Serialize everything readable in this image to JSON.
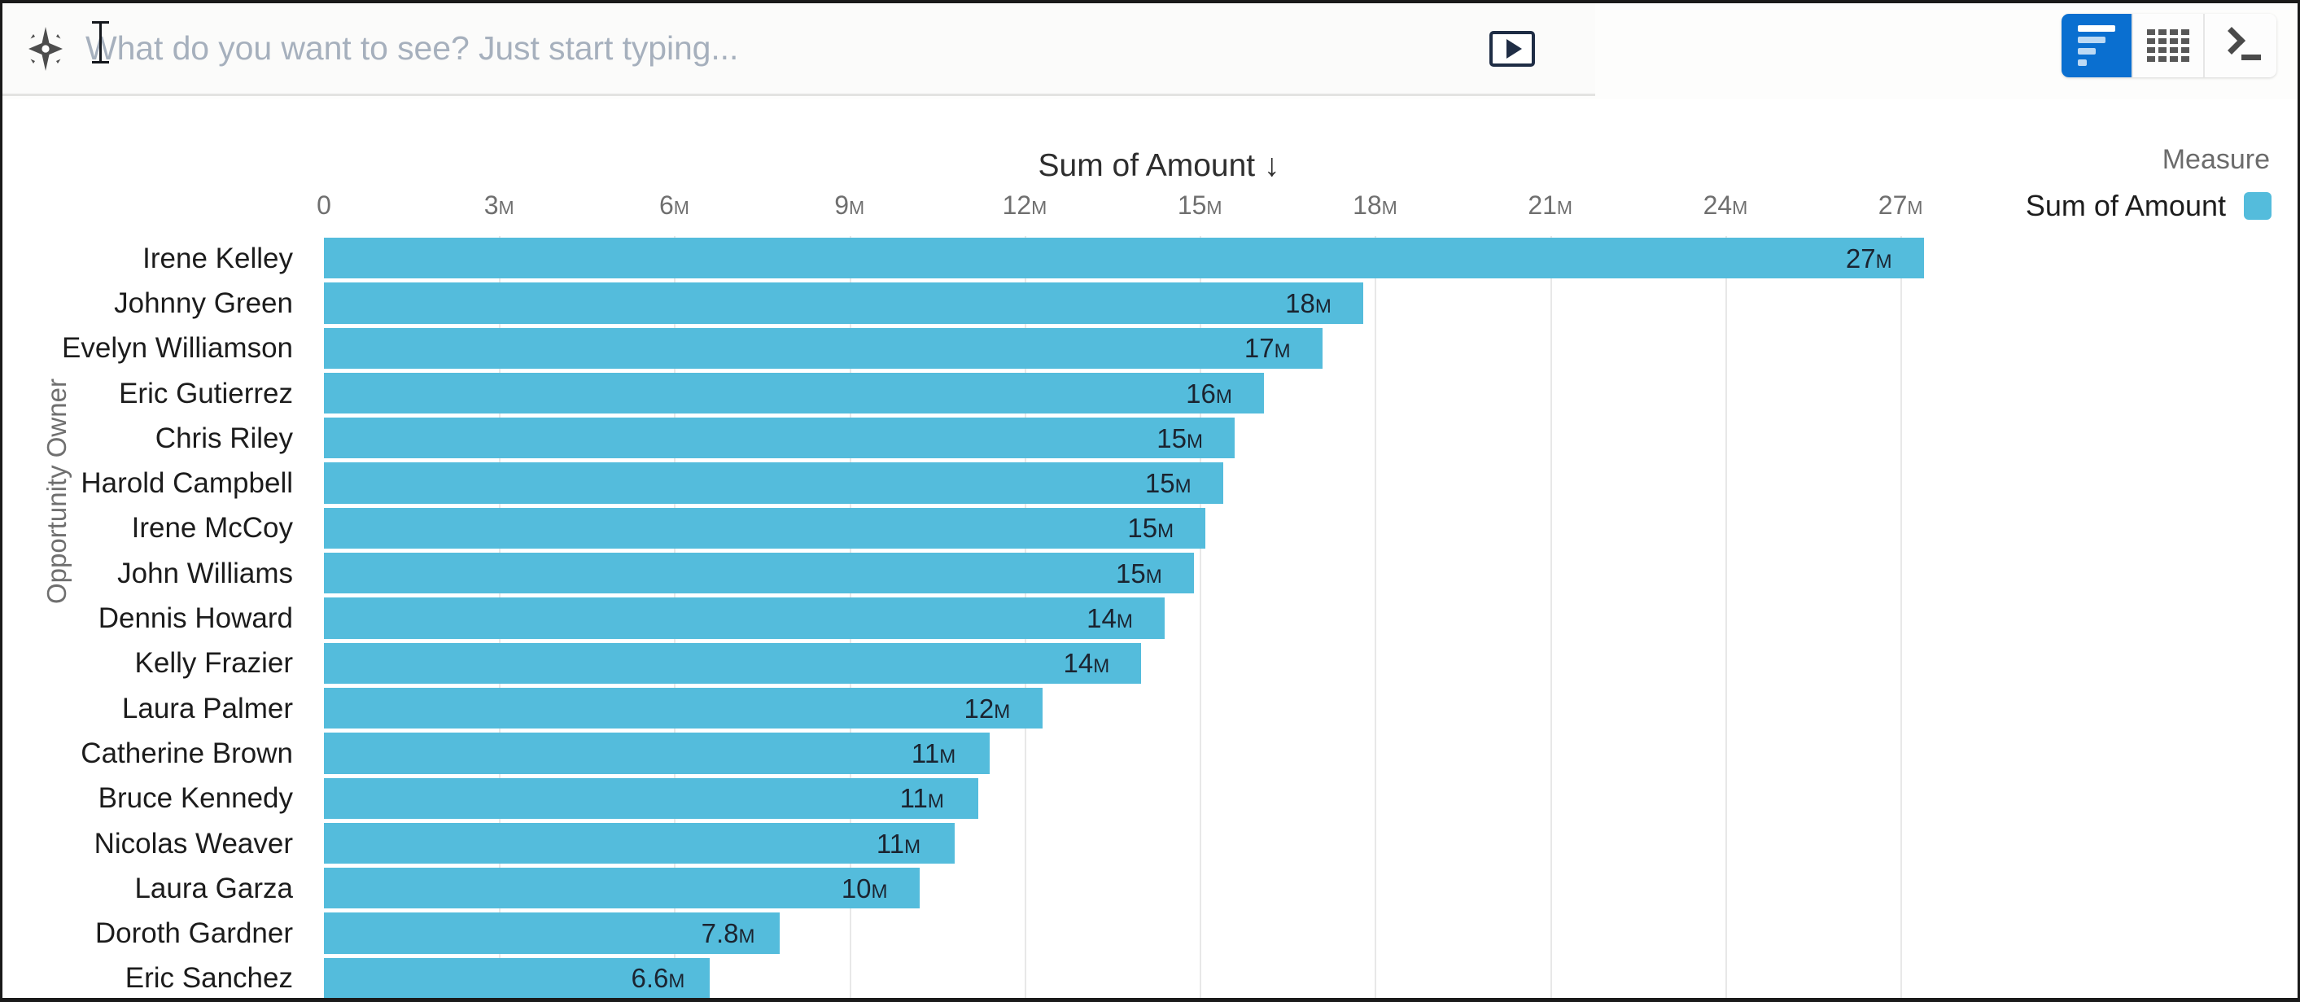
{
  "search": {
    "placeholder": "What do you want to see? Just start typing...",
    "value": "",
    "sparkle_icon": "sparkle-icon",
    "run_icon": "play-icon"
  },
  "view_toggle": {
    "options": [
      {
        "name": "chart-view",
        "icon": "bar-chart-icon",
        "active": true
      },
      {
        "name": "table-view",
        "icon": "grid-icon",
        "active": false
      },
      {
        "name": "code-view",
        "icon": "terminal-icon",
        "active": false
      }
    ],
    "active_color": "#0a6fd0"
  },
  "legend": {
    "title": "Measure",
    "label": "Sum of Amount",
    "color": "#54bcdc"
  },
  "chart_data": {
    "type": "bar",
    "orientation": "horizontal",
    "title": "Sum of Amount ↓",
    "sort": "descending",
    "xlabel": "",
    "ylabel": "Opportunity Owner",
    "xlim": [
      0,
      28.6
    ],
    "xticks": [
      0,
      3,
      6,
      9,
      12,
      15,
      18,
      21,
      24,
      27
    ],
    "xticklabels": [
      "0",
      "3M",
      "6M",
      "9M",
      "12M",
      "15M",
      "18M",
      "21M",
      "24M",
      "27M"
    ],
    "unit": "M",
    "grid": true,
    "legend_position": "right",
    "categories": [
      "Irene Kelley",
      "Johnny Green",
      "Evelyn Williamson",
      "Eric Gutierrez",
      "Chris Riley",
      "Harold Campbell",
      "Irene McCoy",
      "John Williams",
      "Dennis Howard",
      "Kelly Frazier",
      "Laura Palmer",
      "Catherine Brown",
      "Bruce Kennedy",
      "Nicolas Weaver",
      "Laura Garza",
      "Doroth Gardner",
      "Eric Sanchez"
    ],
    "values": [
      27.4,
      17.8,
      17.1,
      16.1,
      15.6,
      15.4,
      15.1,
      14.9,
      14.4,
      14.0,
      12.3,
      11.4,
      11.2,
      10.8,
      10.2,
      7.8,
      6.6
    ],
    "value_labels": [
      "27M",
      "18M",
      "17M",
      "16M",
      "15M",
      "15M",
      "15M",
      "15M",
      "14M",
      "14M",
      "12M",
      "11M",
      "11M",
      "11M",
      "10M",
      "7.8M",
      "6.6M"
    ],
    "series": [
      {
        "name": "Sum of Amount",
        "color": "#54bcdc",
        "values": [
          27.4,
          17.8,
          17.1,
          16.1,
          15.6,
          15.4,
          15.1,
          14.9,
          14.4,
          14.0,
          12.3,
          11.4,
          11.2,
          10.8,
          10.2,
          7.8,
          6.6
        ]
      }
    ]
  }
}
